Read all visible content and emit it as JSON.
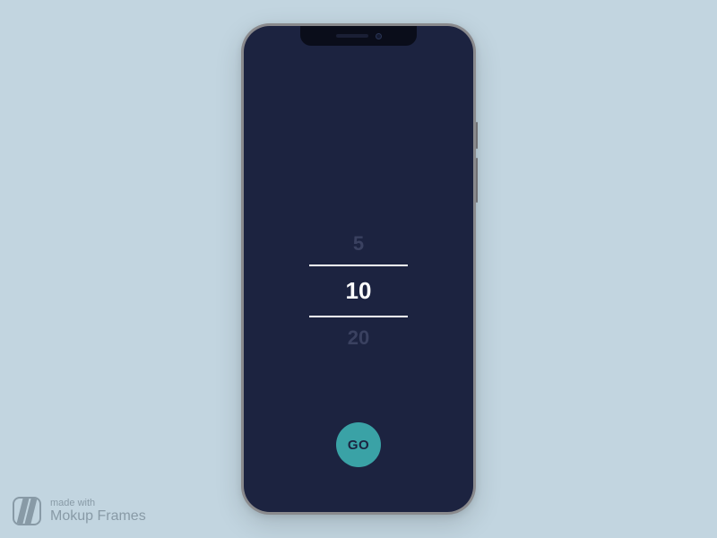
{
  "picker": {
    "prev": "5",
    "selected": "10",
    "next": "20"
  },
  "action": {
    "go_label": "GO"
  },
  "watermark": {
    "line1": "made with",
    "line2": "Mokup Frames"
  }
}
